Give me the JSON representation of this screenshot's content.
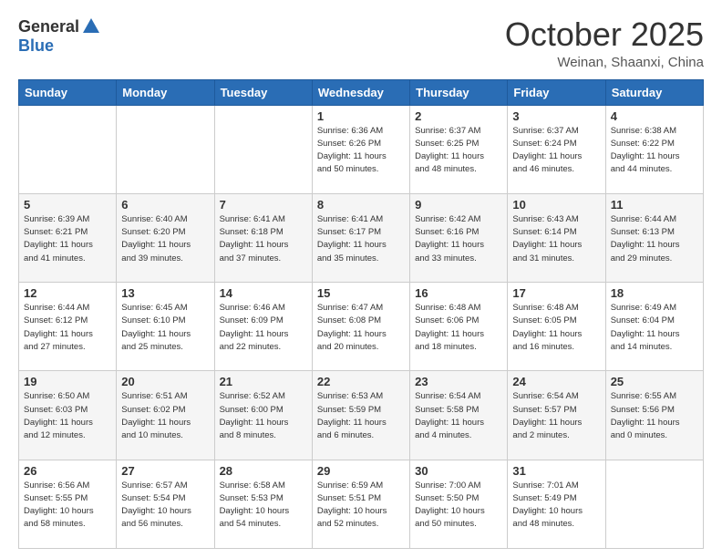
{
  "header": {
    "logo_general": "General",
    "logo_blue": "Blue",
    "month": "October 2025",
    "location": "Weinan, Shaanxi, China"
  },
  "days_of_week": [
    "Sunday",
    "Monday",
    "Tuesday",
    "Wednesday",
    "Thursday",
    "Friday",
    "Saturday"
  ],
  "weeks": [
    [
      {
        "day": "",
        "info": ""
      },
      {
        "day": "",
        "info": ""
      },
      {
        "day": "",
        "info": ""
      },
      {
        "day": "1",
        "info": "Sunrise: 6:36 AM\nSunset: 6:26 PM\nDaylight: 11 hours\nand 50 minutes."
      },
      {
        "day": "2",
        "info": "Sunrise: 6:37 AM\nSunset: 6:25 PM\nDaylight: 11 hours\nand 48 minutes."
      },
      {
        "day": "3",
        "info": "Sunrise: 6:37 AM\nSunset: 6:24 PM\nDaylight: 11 hours\nand 46 minutes."
      },
      {
        "day": "4",
        "info": "Sunrise: 6:38 AM\nSunset: 6:22 PM\nDaylight: 11 hours\nand 44 minutes."
      }
    ],
    [
      {
        "day": "5",
        "info": "Sunrise: 6:39 AM\nSunset: 6:21 PM\nDaylight: 11 hours\nand 41 minutes."
      },
      {
        "day": "6",
        "info": "Sunrise: 6:40 AM\nSunset: 6:20 PM\nDaylight: 11 hours\nand 39 minutes."
      },
      {
        "day": "7",
        "info": "Sunrise: 6:41 AM\nSunset: 6:18 PM\nDaylight: 11 hours\nand 37 minutes."
      },
      {
        "day": "8",
        "info": "Sunrise: 6:41 AM\nSunset: 6:17 PM\nDaylight: 11 hours\nand 35 minutes."
      },
      {
        "day": "9",
        "info": "Sunrise: 6:42 AM\nSunset: 6:16 PM\nDaylight: 11 hours\nand 33 minutes."
      },
      {
        "day": "10",
        "info": "Sunrise: 6:43 AM\nSunset: 6:14 PM\nDaylight: 11 hours\nand 31 minutes."
      },
      {
        "day": "11",
        "info": "Sunrise: 6:44 AM\nSunset: 6:13 PM\nDaylight: 11 hours\nand 29 minutes."
      }
    ],
    [
      {
        "day": "12",
        "info": "Sunrise: 6:44 AM\nSunset: 6:12 PM\nDaylight: 11 hours\nand 27 minutes."
      },
      {
        "day": "13",
        "info": "Sunrise: 6:45 AM\nSunset: 6:10 PM\nDaylight: 11 hours\nand 25 minutes."
      },
      {
        "day": "14",
        "info": "Sunrise: 6:46 AM\nSunset: 6:09 PM\nDaylight: 11 hours\nand 22 minutes."
      },
      {
        "day": "15",
        "info": "Sunrise: 6:47 AM\nSunset: 6:08 PM\nDaylight: 11 hours\nand 20 minutes."
      },
      {
        "day": "16",
        "info": "Sunrise: 6:48 AM\nSunset: 6:06 PM\nDaylight: 11 hours\nand 18 minutes."
      },
      {
        "day": "17",
        "info": "Sunrise: 6:48 AM\nSunset: 6:05 PM\nDaylight: 11 hours\nand 16 minutes."
      },
      {
        "day": "18",
        "info": "Sunrise: 6:49 AM\nSunset: 6:04 PM\nDaylight: 11 hours\nand 14 minutes."
      }
    ],
    [
      {
        "day": "19",
        "info": "Sunrise: 6:50 AM\nSunset: 6:03 PM\nDaylight: 11 hours\nand 12 minutes."
      },
      {
        "day": "20",
        "info": "Sunrise: 6:51 AM\nSunset: 6:02 PM\nDaylight: 11 hours\nand 10 minutes."
      },
      {
        "day": "21",
        "info": "Sunrise: 6:52 AM\nSunset: 6:00 PM\nDaylight: 11 hours\nand 8 minutes."
      },
      {
        "day": "22",
        "info": "Sunrise: 6:53 AM\nSunset: 5:59 PM\nDaylight: 11 hours\nand 6 minutes."
      },
      {
        "day": "23",
        "info": "Sunrise: 6:54 AM\nSunset: 5:58 PM\nDaylight: 11 hours\nand 4 minutes."
      },
      {
        "day": "24",
        "info": "Sunrise: 6:54 AM\nSunset: 5:57 PM\nDaylight: 11 hours\nand 2 minutes."
      },
      {
        "day": "25",
        "info": "Sunrise: 6:55 AM\nSunset: 5:56 PM\nDaylight: 11 hours\nand 0 minutes."
      }
    ],
    [
      {
        "day": "26",
        "info": "Sunrise: 6:56 AM\nSunset: 5:55 PM\nDaylight: 10 hours\nand 58 minutes."
      },
      {
        "day": "27",
        "info": "Sunrise: 6:57 AM\nSunset: 5:54 PM\nDaylight: 10 hours\nand 56 minutes."
      },
      {
        "day": "28",
        "info": "Sunrise: 6:58 AM\nSunset: 5:53 PM\nDaylight: 10 hours\nand 54 minutes."
      },
      {
        "day": "29",
        "info": "Sunrise: 6:59 AM\nSunset: 5:51 PM\nDaylight: 10 hours\nand 52 minutes."
      },
      {
        "day": "30",
        "info": "Sunrise: 7:00 AM\nSunset: 5:50 PM\nDaylight: 10 hours\nand 50 minutes."
      },
      {
        "day": "31",
        "info": "Sunrise: 7:01 AM\nSunset: 5:49 PM\nDaylight: 10 hours\nand 48 minutes."
      },
      {
        "day": "",
        "info": ""
      }
    ]
  ]
}
